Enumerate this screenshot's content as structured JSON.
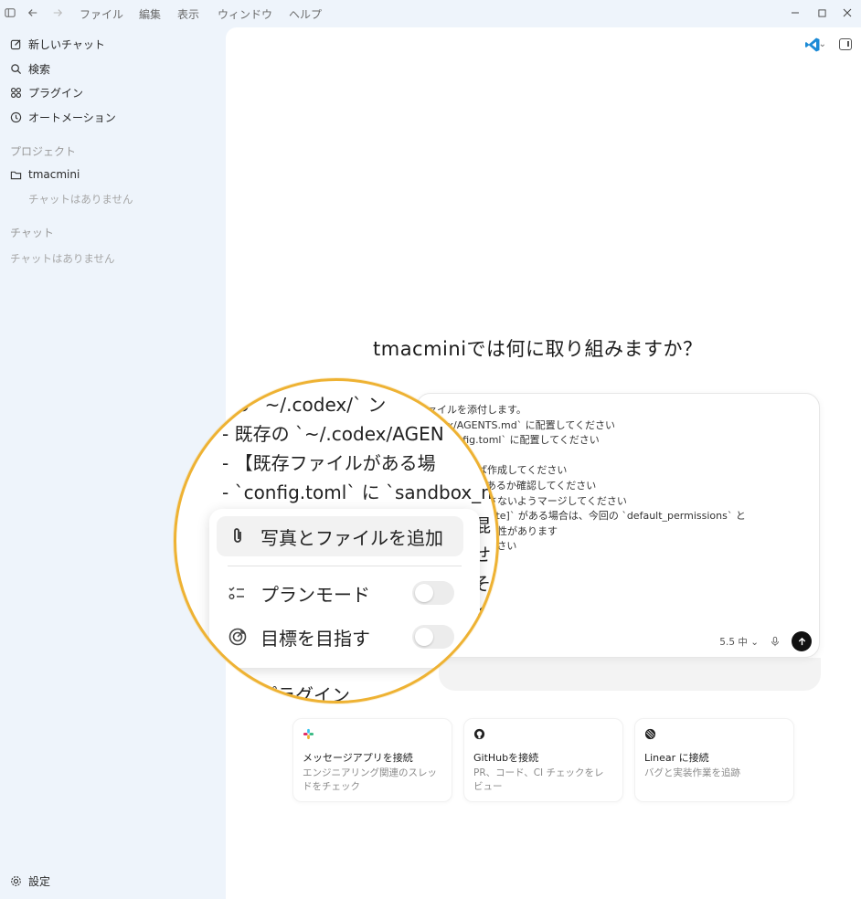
{
  "menu": [
    "ファイル",
    "編集",
    "表示",
    "ウィンドウ",
    "ヘルプ"
  ],
  "sidebar": {
    "items": [
      {
        "label": "新しいチャット",
        "icon": "edit-icon"
      },
      {
        "label": "検索",
        "icon": "search-icon"
      },
      {
        "label": "プラグイン",
        "icon": "plugins-icon"
      },
      {
        "label": "オートメーション",
        "icon": "clock-icon"
      }
    ],
    "projects_label": "プロジェクト",
    "project_name": "tmacmini",
    "project_empty": "チャットはありません",
    "chats_label": "チャット",
    "chats_empty": "チャットはありません",
    "settings_label": "設定"
  },
  "main": {
    "heading": "tmacminiでは何に取り組みますか？",
    "composer_lines": [
      "ファイルを添付します。",
      "/.codex/AGENTS.md` に配置してください",
      "odex/config.toml` に配置してください",
      "",
      "認し、なければ作成してください",
      "onfig.toml` があるか確認してください",
      "既存の設定を壊さないようマージしてください",
      "_workspace_write]` がある場合は、今回の `default_permissions` と",
      "が優先される可能性があります",
      "から適用してください",
      "です"
    ],
    "model_label": "5.5 中"
  },
  "magnifier": {
    "bg_lines": [
      "- 9 `~/.codex/` ン",
      "- 既存の `~/.codex/AGEN",
      "- 【既存ファイルがある場",
      "- `config.toml` に `sandbox_m"
    ],
    "right_fragments": [
      "混",
      "せ",
      "そ",
      "く",
      "ら"
    ],
    "menu_items": [
      {
        "label": "写真とファイルを追加",
        "icon": "paperclip-icon"
      },
      {
        "label": "プランモード",
        "icon": "checklist-icon",
        "toggle": false
      },
      {
        "label": "目標を目指す",
        "icon": "target-icon",
        "toggle": false
      }
    ],
    "bottom_text": "プラグイン"
  },
  "cards": [
    {
      "title": "メッセージアプリを接続",
      "desc": "エンジニアリング関連のスレッドをチェック",
      "icon": "slack-icon"
    },
    {
      "title": "GitHubを接続",
      "desc": "PR、コード、CI チェックをレビュー",
      "icon": "github-icon"
    },
    {
      "title": "Linear に接続",
      "desc": "バグと実装作業を追跡",
      "icon": "linear-icon"
    }
  ],
  "colors": {
    "accent": "#eeb233",
    "sidebar_bg": "#eef4fb"
  }
}
